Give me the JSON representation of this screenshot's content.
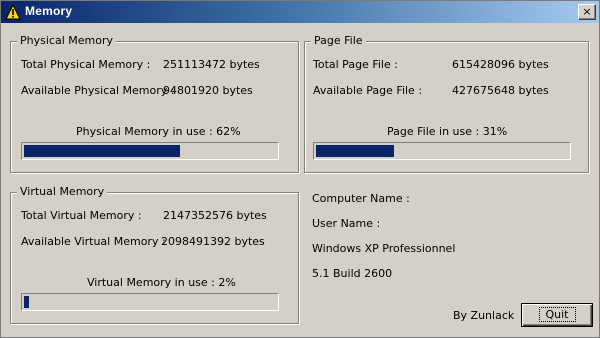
{
  "window": {
    "title": "Memory",
    "close_glyph": "×"
  },
  "physical": {
    "legend": "Physical Memory",
    "total_label": "Total Physical Memory :",
    "total_value": "251113472 bytes",
    "avail_label": "Available Physical Memory :",
    "avail_value": "94801920 bytes",
    "usage_caption": "Physical Memory in use : 62%",
    "usage_fraction": 0.62
  },
  "pagefile": {
    "legend": "Page File",
    "total_label": "Total Page File :",
    "total_value": "615428096 bytes",
    "avail_label": "Available Page File :",
    "avail_value": "427675648 bytes",
    "usage_caption": "Page File in use : 31%",
    "usage_fraction": 0.31
  },
  "virtual": {
    "legend": "Virtual Memory",
    "total_label": "Total Virtual Memory :",
    "total_value": "2147352576 bytes",
    "avail_label": "Available Virtual Memory :",
    "avail_value": "2098491392 bytes",
    "usage_caption": "Virtual Memory in use : 2%",
    "usage_fraction": 0.02
  },
  "system": {
    "computer_name": "Computer Name :",
    "user_name": "User Name :",
    "os_name": "Windows XP Professionnel",
    "os_build": "5.1 Build 2600"
  },
  "footer": {
    "credit": "By Zunlack",
    "quit_label": "Quit"
  },
  "colors": {
    "title_start": "#0a246a",
    "title_end": "#a6caf0",
    "bar_fill": "#0a246a",
    "face": "#d4d0c8"
  },
  "icons": {
    "title_icon": "warning-icon",
    "close": "close-icon"
  }
}
